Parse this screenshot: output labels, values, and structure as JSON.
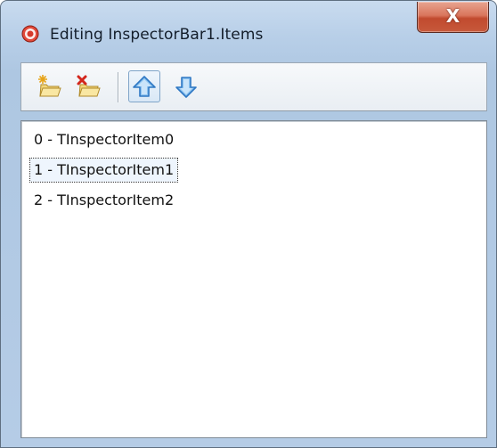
{
  "window": {
    "title": "Editing InspectorBar1.Items",
    "close_label": "X"
  },
  "toolbar": {
    "buttons": [
      {
        "name": "add-item",
        "icon": "folder-new-icon"
      },
      {
        "name": "delete-item",
        "icon": "folder-delete-icon"
      },
      {
        "name": "move-up",
        "icon": "arrow-up-icon",
        "pressed": true
      },
      {
        "name": "move-down",
        "icon": "arrow-down-icon"
      }
    ]
  },
  "list": {
    "items": [
      {
        "label": "0 - TInspectorItem0"
      },
      {
        "label": "1 - TInspectorItem1",
        "focused": true
      },
      {
        "label": "2 - TInspectorItem2"
      }
    ]
  },
  "colors": {
    "frame": "#b8cfe8",
    "close_button": "#c7593c",
    "arrow": "#3a8ad6"
  }
}
